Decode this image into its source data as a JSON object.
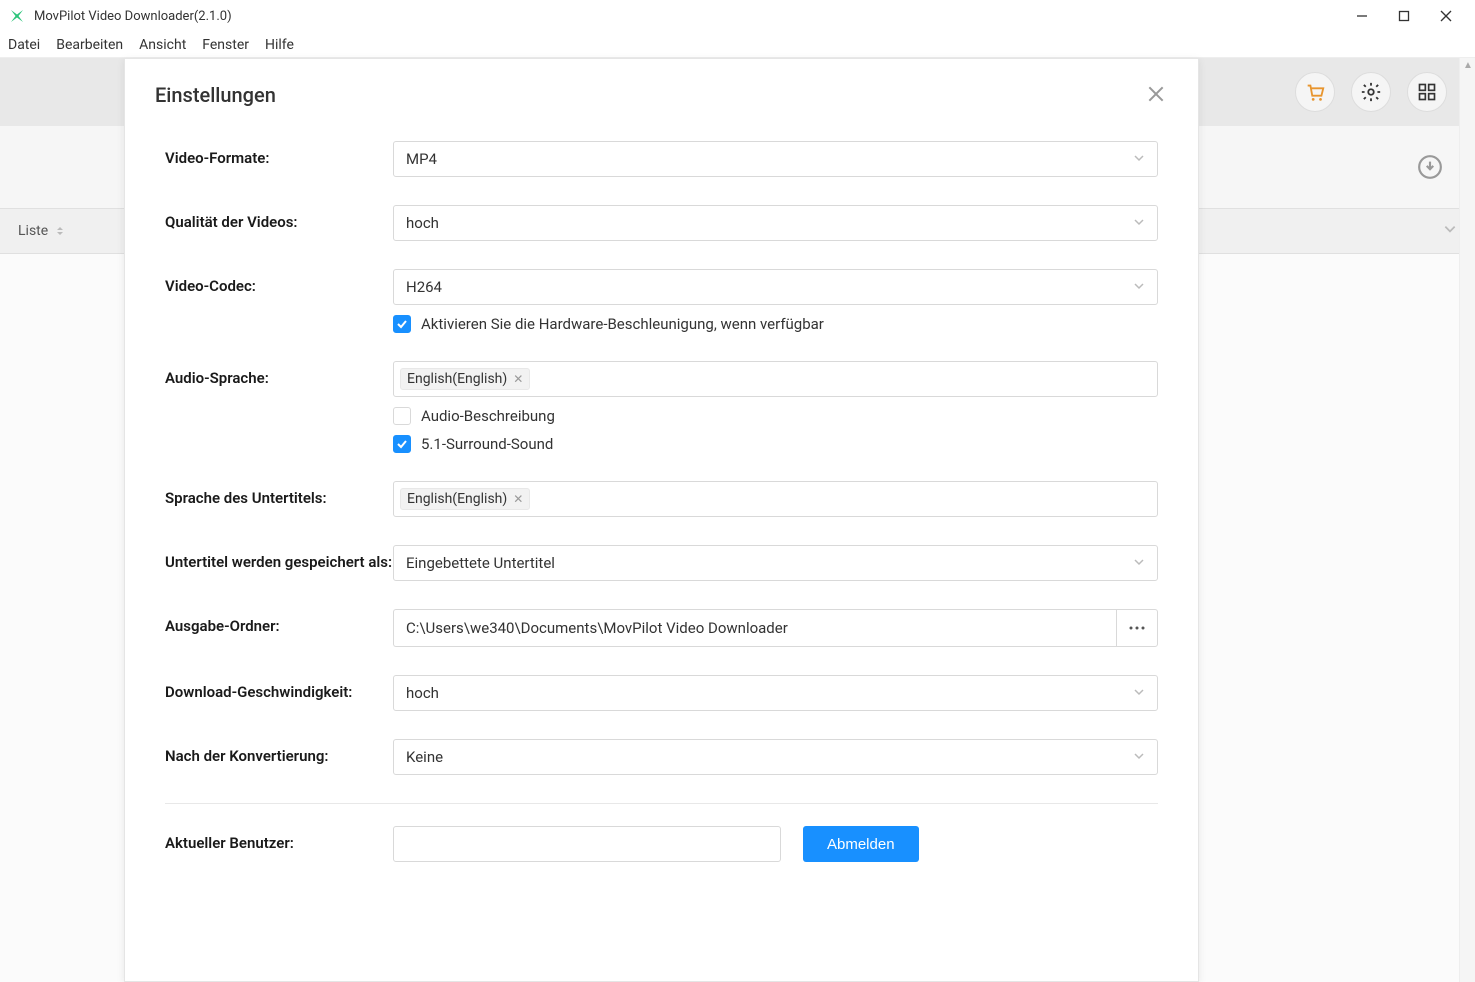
{
  "window": {
    "title": "MovPilot Video Downloader(2.1.0)"
  },
  "menu": {
    "datei": "Datei",
    "bearbeiten": "Bearbeiten",
    "ansicht": "Ansicht",
    "fenster": "Fenster",
    "hilfe": "Hilfe"
  },
  "bg": {
    "liste": "Liste"
  },
  "modal": {
    "title": "Einstellungen",
    "labels": {
      "videoFormate": "Video-Formate:",
      "qualitaet": "Qualität der Videos:",
      "codec": "Video-Codec:",
      "hw": "Aktivieren Sie die Hardware-Beschleunigung, wenn verfügbar",
      "audioSprache": "Audio-Sprache:",
      "audioBeschreibung": "Audio-Beschreibung",
      "surround": "5.1-Surround-Sound",
      "untertitelSprache": "Sprache des Untertitels:",
      "untertitelSpeichern": "Untertitel werden gespeichert als:",
      "ausgabe": "Ausgabe-Ordner:",
      "downloadSpeed": "Download-Geschwindigkeit:",
      "nachKonv": "Nach der Konvertierung:",
      "aktuellerBenutzer": "Aktueller Benutzer:"
    },
    "values": {
      "videoFormate": "MP4",
      "qualitaet": "hoch",
      "codec": "H264",
      "hwChecked": true,
      "audioTag": "English(English)",
      "audioBeschreibungChecked": false,
      "surroundChecked": true,
      "untertitelTag": "English(English)",
      "untertitelSpeichern": "Eingebettete Untertitel",
      "ausgabe": "C:\\Users\\we340\\Documents\\MovPilot Video Downloader",
      "downloadSpeed": "hoch",
      "nachKonv": "Keine",
      "aktuellerBenutzer": ""
    },
    "buttons": {
      "abmelden": "Abmelden"
    }
  }
}
